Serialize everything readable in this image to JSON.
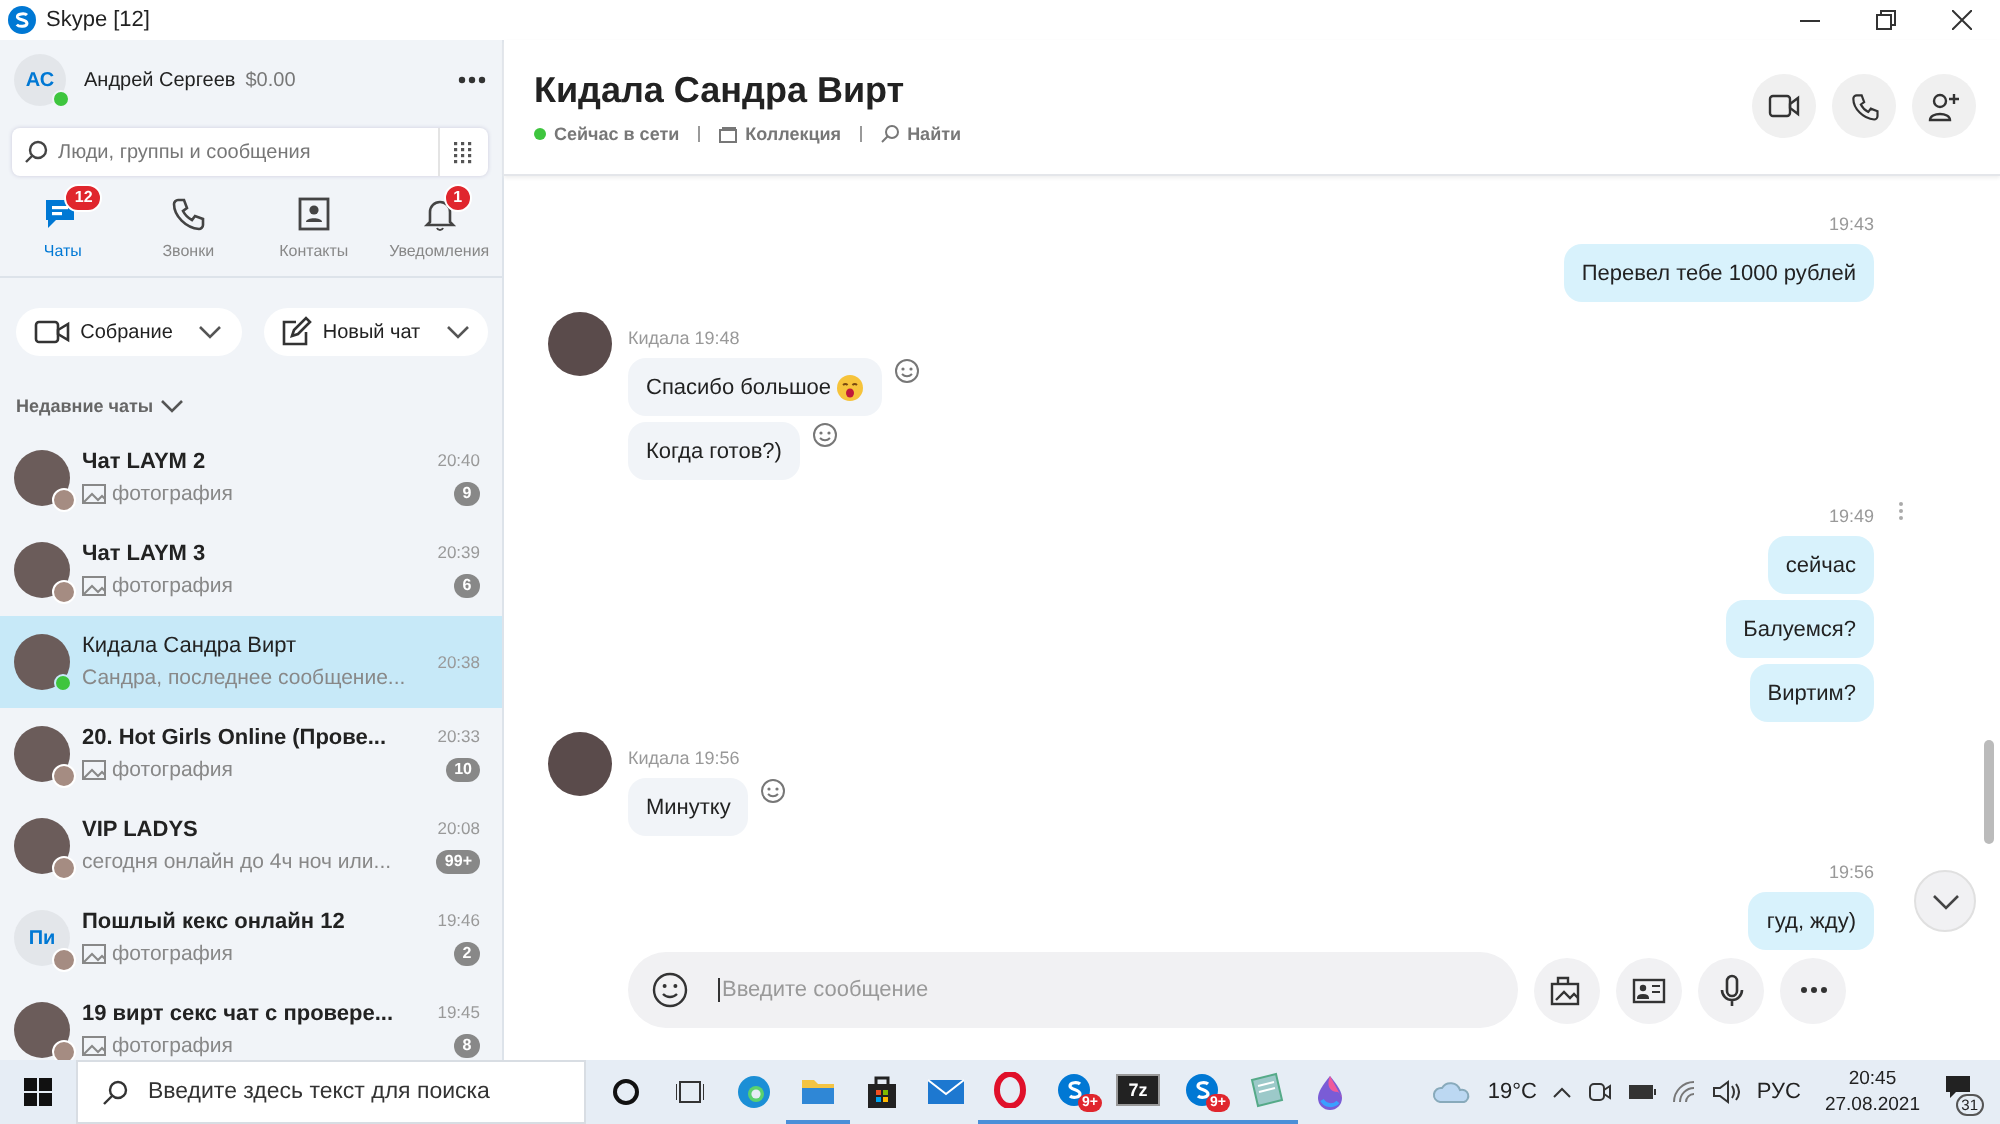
{
  "window": {
    "title": "Skype [12]"
  },
  "profile": {
    "initials": "АС",
    "name": "Андрей Сергеев",
    "balance": "$0.00",
    "online": true
  },
  "search": {
    "placeholder": "Люди, группы и сообщения"
  },
  "nav_tabs": [
    {
      "kind": "chats",
      "label": "Чаты",
      "badge": "12",
      "selected": true
    },
    {
      "kind": "calls",
      "label": "Звонки",
      "selected": false
    },
    {
      "kind": "contacts",
      "label": "Контакты",
      "selected": false
    },
    {
      "kind": "notifications",
      "label": "Уведомления",
      "badge": "1",
      "selected": false
    }
  ],
  "actions": [
    {
      "kind": "meeting",
      "label": "Собрание"
    },
    {
      "kind": "new_chat",
      "label": "Новый чат"
    }
  ],
  "recent_header": "Недавние чаты",
  "chats": [
    {
      "name": "Чат LAYM 2",
      "kind": "photo",
      "preview": "фотография",
      "time": "20:40",
      "unread": "9",
      "group": true,
      "selected": false,
      "online": false
    },
    {
      "name": "Чат LAYM 3",
      "kind": "photo",
      "preview": "фотография",
      "time": "20:39",
      "unread": "6",
      "group": true,
      "selected": false,
      "online": false
    },
    {
      "name": "Кидала Сандра Вирт",
      "kind": "text",
      "preview": "Сандра, последнее сообщение...",
      "time": "20:38",
      "group": false,
      "selected": true,
      "online": true
    },
    {
      "name": "20. Hot Girls Online (Прове...",
      "kind": "photo",
      "preview": "фотография",
      "time": "20:33",
      "unread": "10",
      "group": true,
      "selected": false,
      "online": false
    },
    {
      "name": "VIP LADYS",
      "kind": "text",
      "preview": "сегодня онлайн до 4ч ноч или...",
      "time": "20:08",
      "unread": "99+",
      "group": true,
      "selected": false,
      "online": false
    },
    {
      "name": "Пошлый кекс онлайн 12",
      "avatar_initials": "Пи",
      "kind": "photo",
      "preview": "фотография",
      "time": "19:46",
      "unread": "2",
      "group": true,
      "selected": false,
      "online": false
    },
    {
      "name": "19 вирт секс чат с провере...",
      "kind": "photo",
      "preview": "фотография",
      "time": "19:45",
      "unread": "8",
      "group": true,
      "selected": false,
      "online": false
    }
  ],
  "conversation": {
    "title": "Кидала Сандра Вирт",
    "status": "Сейчас в сети",
    "online": true,
    "links": [
      {
        "kind": "gallery",
        "label": "Коллекция"
      },
      {
        "kind": "find",
        "label": "Найти"
      }
    ]
  },
  "messages": [
    {
      "kind": "outgoing",
      "time": "19:43",
      "bubbles": [
        {
          "text": "Перевел тебе 1000 рублей"
        }
      ]
    },
    {
      "kind": "incoming",
      "sender": "Кидала",
      "time": "19:48",
      "bubbles": [
        {
          "text": "Спасибо большое",
          "emoticon": true
        },
        {
          "text": "Когда готов?)"
        }
      ]
    },
    {
      "kind": "outgoing",
      "time": "19:49",
      "bubbles": [
        {
          "text": "сейчас"
        },
        {
          "text": "Балуемся?"
        },
        {
          "text": "Виртим?"
        }
      ]
    },
    {
      "kind": "incoming",
      "sender": "Кидала",
      "time": "19:56",
      "bubbles": [
        {
          "text": "Минутку"
        }
      ]
    },
    {
      "kind": "outgoing",
      "time": "19:56",
      "bubbles": [
        {
          "text": "гуд, жду)"
        }
      ]
    }
  ],
  "composer": {
    "placeholder": "Введите сообщение"
  },
  "taskbar": {
    "search_placeholder": "Введите здесь текст для поиска",
    "apps": [
      {
        "kind": "cortana",
        "running": false
      },
      {
        "kind": "taskview",
        "running": false
      },
      {
        "kind": "edge",
        "running": false
      },
      {
        "kind": "explorer",
        "running": true
      },
      {
        "kind": "store",
        "running": false
      },
      {
        "kind": "mail",
        "running": false
      },
      {
        "kind": "opera",
        "running": true
      },
      {
        "kind": "skype",
        "badge": "9+",
        "running": true
      },
      {
        "kind": "archiver",
        "label": "7z",
        "running": true
      },
      {
        "kind": "skype",
        "badge": "9+",
        "running": true
      },
      {
        "kind": "notepad",
        "running": true
      },
      {
        "kind": "paint",
        "running": false
      }
    ],
    "weather": "19°C",
    "language": "РУС",
    "time": "20:45",
    "date": "27.08.2021",
    "notifications": "31"
  }
}
